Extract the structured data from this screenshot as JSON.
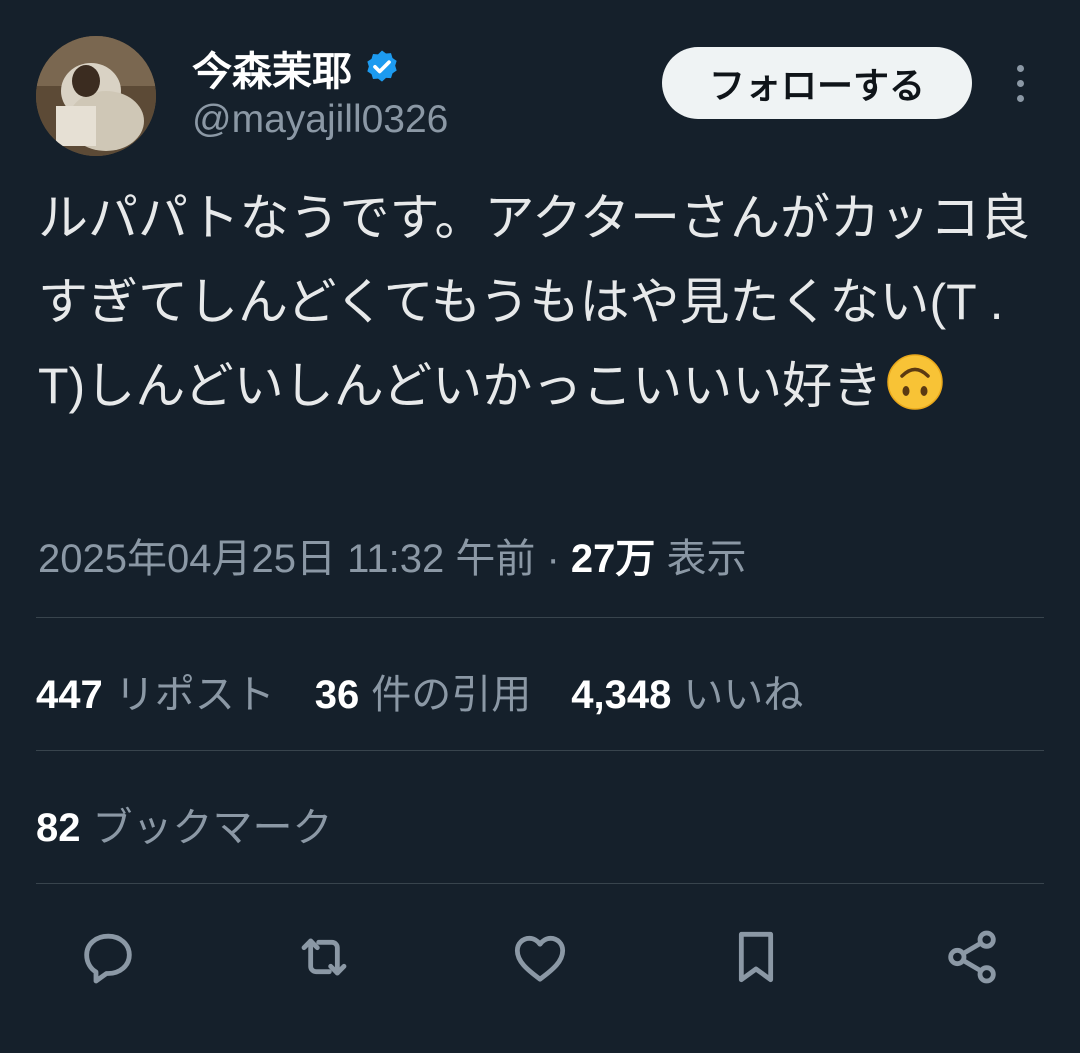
{
  "author": {
    "display_name": "今森茉耶",
    "handle": "@mayajill0326",
    "verified_icon": "verified-badge-icon"
  },
  "header": {
    "follow_label": "フォローする",
    "more_icon": "more-dots-icon"
  },
  "tweet": {
    "text": "ルパパトなうです。アクターさんがカッコ良すぎてしんどくてもうもはや見たくない(T . T)しんどいしんどいかっこいいい好き",
    "emoji": "upside-down-face-emoji",
    "timestamp": "2025年04月25日 11:32 午前",
    "separator": "·",
    "views_count": "27万",
    "views_label": "表示"
  },
  "stats": {
    "reposts": {
      "count": "447",
      "label": "リポスト"
    },
    "quotes": {
      "count": "36",
      "label": "件の引用"
    },
    "likes": {
      "count": "4,348",
      "label": "いいね"
    },
    "bookmarks": {
      "count": "82",
      "label": "ブックマーク"
    }
  },
  "actions": [
    "reply-icon",
    "repost-icon",
    "like-icon",
    "bookmark-icon",
    "share-icon"
  ],
  "colors": {
    "background": "#15202b",
    "secondary_text": "#8b98a5",
    "divider": "#38444d",
    "verified": "#1d9bf0",
    "button_bg": "#eff3f4"
  }
}
